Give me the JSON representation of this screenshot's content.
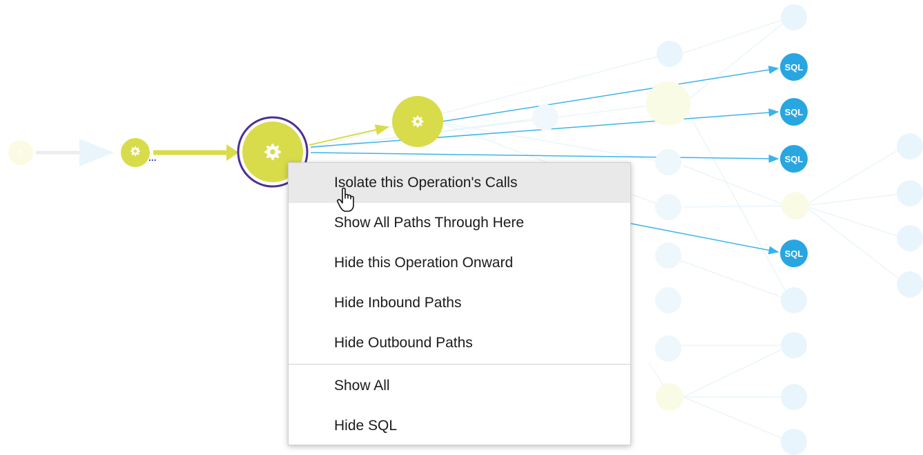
{
  "colors": {
    "operation_node": "#d9dc4a",
    "selected_ring": "#4b2e96",
    "sql_node": "#28a6e2",
    "edge_active": "#3bb3ea",
    "edge_operation": "#d9dc4a",
    "faded": "#e6f3fb"
  },
  "graph": {
    "sql_label": "SQL",
    "unknown_label": "?",
    "ellipsis": "...",
    "operation_icon": "gear-icon"
  },
  "context_menu": {
    "items": [
      "Isolate this Operation's Calls",
      "Show All Paths Through Here",
      "Hide this Operation Onward",
      "Hide Inbound Paths",
      "Hide Outbound Paths"
    ],
    "secondary_items": [
      "Show All",
      "Hide SQL"
    ],
    "hovered_index": 0
  }
}
